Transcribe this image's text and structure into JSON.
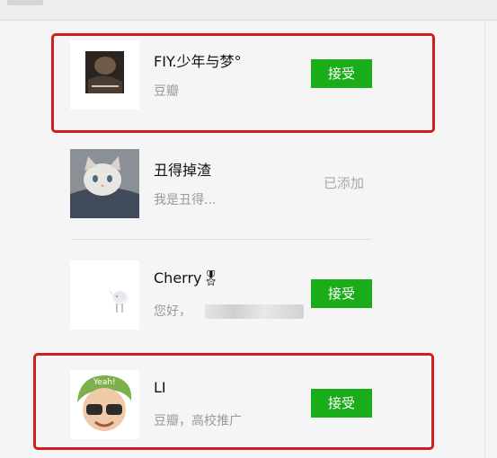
{
  "requests": [
    {
      "name": "FIY.少年与梦°",
      "message": "豆瓣",
      "action": "接受",
      "avatar_icon": "album-cover-avatar"
    },
    {
      "name": "丑得掉渣",
      "message": "我是丑得...",
      "status": "已添加",
      "avatar_icon": "cat-avatar"
    },
    {
      "name": "Cherry🎖",
      "message": "您好，",
      "action": "接受",
      "avatar_icon": "lamb-avatar"
    },
    {
      "name": "LI",
      "message": "豆瓣，高校推广",
      "action": "接受",
      "avatar_icon": "cartoon-avatar"
    }
  ],
  "colors": {
    "accept_button": "#1aad19",
    "highlight": "#d21d1d",
    "muted_text": "#999999"
  }
}
